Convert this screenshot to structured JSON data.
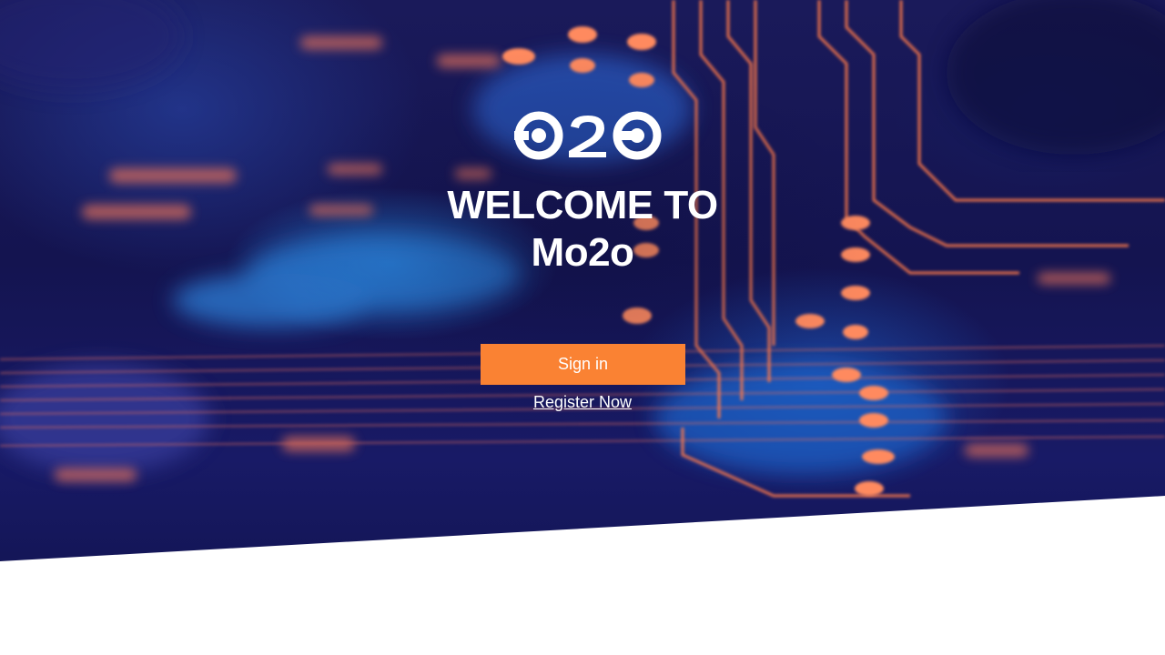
{
  "brand": {
    "logo_icon": "mo2o-logo-icon",
    "logo_text": "O2O"
  },
  "welcome": {
    "line1": "WELCOME TO",
    "line2": "Mo2o"
  },
  "actions": {
    "signin_label": "Sign in",
    "register_label": "Register Now"
  },
  "colors": {
    "accent": "#fa8233",
    "hero_dark": "#141450",
    "circuit_orange": "#ff7a4a",
    "text": "#ffffff"
  }
}
